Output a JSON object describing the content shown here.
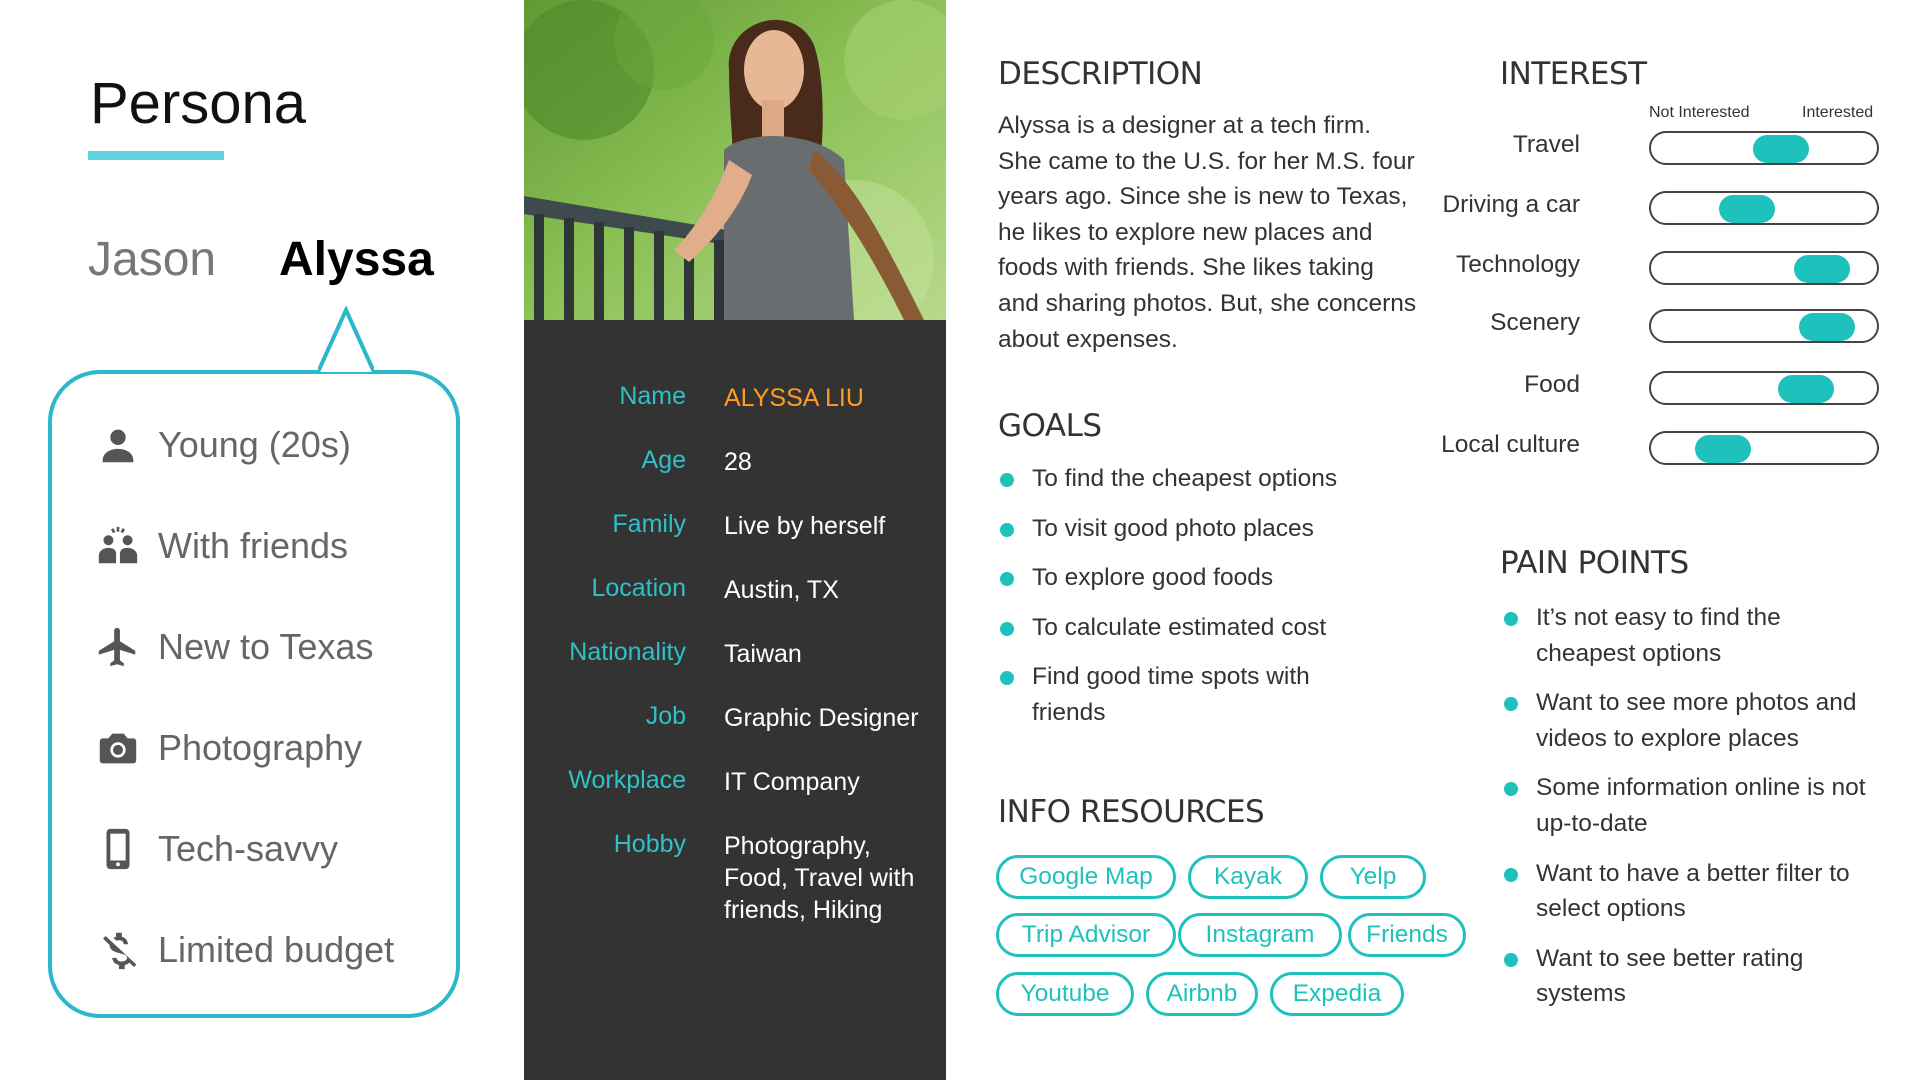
{
  "page_title": "Persona",
  "tabs": [
    {
      "label": "Jason"
    },
    {
      "label": "Alyssa"
    }
  ],
  "traits": [
    {
      "icon": "person-icon",
      "label": "Young (20s)"
    },
    {
      "icon": "group-icon",
      "label": "With friends"
    },
    {
      "icon": "airplane-icon",
      "label": "New to Texas"
    },
    {
      "icon": "camera-icon",
      "label": "Photography"
    },
    {
      "icon": "smartphone-icon",
      "label": "Tech-savvy"
    },
    {
      "icon": "money-off-icon",
      "label": "Limited budget"
    }
  ],
  "profile": [
    {
      "label": "Name",
      "value": "ALYSSA LIU"
    },
    {
      "label": "Age",
      "value": "28"
    },
    {
      "label": "Family",
      "value": "Live by herself"
    },
    {
      "label": "Location",
      "value": "Austin, TX"
    },
    {
      "label": "Nationality",
      "value": "Taiwan"
    },
    {
      "label": "Job",
      "value": "Graphic Designer"
    },
    {
      "label": "Workplace",
      "value": "IT Company"
    },
    {
      "label": "Hobby",
      "value": "Photography, Food, Travel with friends, Hiking"
    }
  ],
  "description": {
    "title": "DESCRIPTION",
    "text": "Alyssa is a designer at a tech firm. She came to the U.S. for her M.S. four years ago. Since she is new to Texas, he likes to explore new places and foods with friends. She likes taking and sharing photos. But, she concerns about expenses."
  },
  "goals": {
    "title": "GOALS",
    "items": [
      "To find the cheapest options",
      "To visit good photo places",
      "To explore good foods",
      "To calculate estimated cost",
      "Find good time spots with friends"
    ]
  },
  "info_resources": {
    "title": "INFO RESOURCES",
    "items": [
      "Google Map",
      "Kayak",
      "Yelp",
      "Trip Advisor",
      "Instagram",
      "Friends",
      "Youtube",
      "Airbnb",
      "Expedia"
    ]
  },
  "interest": {
    "title": "INTEREST",
    "scale_low": "Not Interested",
    "scale_high": "Interested",
    "items": [
      {
        "label": "Travel",
        "level": 0.6
      },
      {
        "label": "Driving a car",
        "level": 0.4
      },
      {
        "label": "Technology",
        "level": 0.85
      },
      {
        "label": "Scenery",
        "level": 0.88
      },
      {
        "label": "Food",
        "level": 0.75
      },
      {
        "label": "Local culture",
        "level": 0.25
      }
    ]
  },
  "pain_points": {
    "title": "PAIN POINTS",
    "items": [
      "It’s not easy to find the cheapest options",
      "Want to see more photos and videos to explore places",
      "Some information online is not up-to-date",
      "Want to have a better filter to select options",
      "Want to see better rating systems"
    ]
  },
  "colors": {
    "accent": "#1fc1bd",
    "bubble_border": "#2bb7cc",
    "name_highlight": "#ff9b21",
    "panel_bg": "#333333",
    "label_teal": "#2ec1c8"
  }
}
